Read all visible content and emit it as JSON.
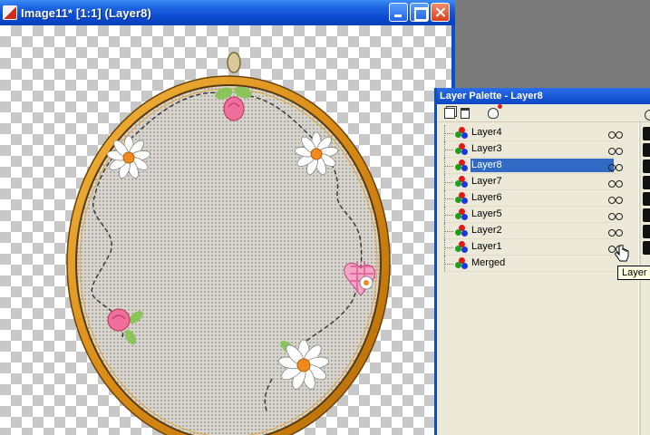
{
  "image_window": {
    "title": "Image11* [1:1] (Layer8)",
    "buttons": {
      "minimize": "minimize-icon",
      "maximize": "maximize-icon",
      "close": "close-icon"
    }
  },
  "layer_palette": {
    "title": "Layer Palette - Layer8",
    "toolbar": [
      "new-layer-icon",
      "delete-layer-icon",
      "new-mask-icon"
    ],
    "layers": [
      {
        "name": "Layer4",
        "selected": false
      },
      {
        "name": "Layer3",
        "selected": false
      },
      {
        "name": "Layer8",
        "selected": true
      },
      {
        "name": "Layer7",
        "selected": false
      },
      {
        "name": "Layer6",
        "selected": false
      },
      {
        "name": "Layer5",
        "selected": false
      },
      {
        "name": "Layer2",
        "selected": false
      },
      {
        "name": "Layer1",
        "selected": false
      },
      {
        "name": "Merged",
        "selected": false
      }
    ],
    "tooltip": "Layer V",
    "selection_color": "#316ac5"
  },
  "colors": {
    "titlebar_blue": "#0a4ec8",
    "hoop_gold": "#e09a22",
    "fabric": "#dcd9d2"
  }
}
